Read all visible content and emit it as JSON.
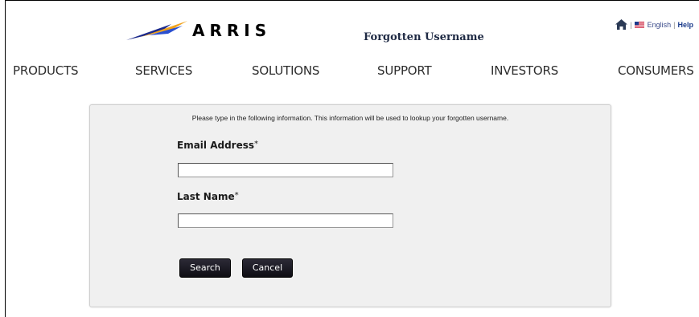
{
  "header": {
    "logo_text": "ARRIS",
    "title": "Forgotten Username",
    "utility": {
      "home_icon": "home-icon",
      "flag_icon": "us-flag-icon",
      "language": "English",
      "help": "Help"
    }
  },
  "nav": {
    "items": [
      "PRODUCTS",
      "SERVICES",
      "SOLUTIONS",
      "SUPPORT",
      "INVESTORS",
      "CONSUMERS"
    ]
  },
  "form": {
    "intro": "Please type in the following information. This information will be used to lookup your forgotten username.",
    "email_label": "Email Address",
    "email_value": "",
    "last_name_label": "Last Name",
    "last_name_value": "",
    "required_marker": "*",
    "search_label": "Search",
    "cancel_label": "Cancel"
  },
  "colors": {
    "brand_blue": "#1c2a8c",
    "button_dark": "#15141c",
    "panel_bg": "#f0f0f0"
  }
}
